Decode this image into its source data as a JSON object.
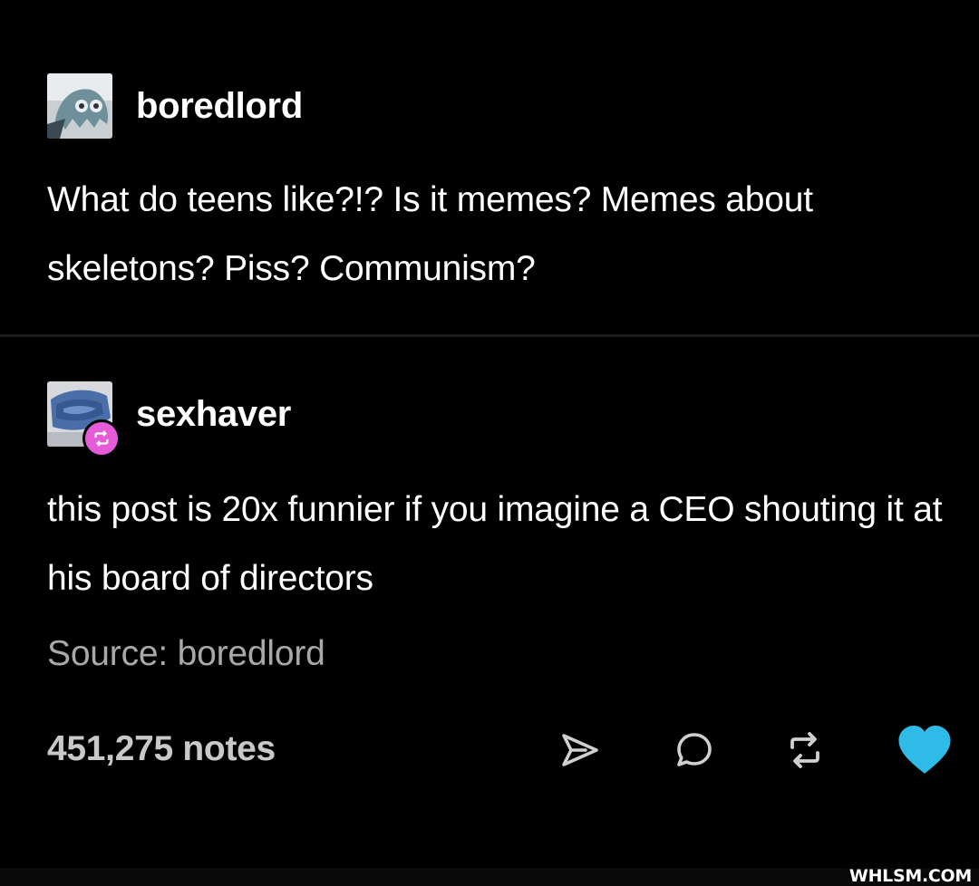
{
  "original_post": {
    "username": "boredlord",
    "avatar_icon": "ghost-avatar-icon",
    "text": "What do teens like?!? Is it memes? Memes about skeletons? Piss? Communism?"
  },
  "reblog_post": {
    "username": "sexhaver",
    "avatar_icon": "blue-painted-avatar-icon",
    "badge_icon": "reblog-badge-icon",
    "text": "this post is 20x funnier if you imagine a CEO shouting it at his board of directors",
    "source": "Source: boredlord"
  },
  "footer": {
    "notes": "451,275 notes",
    "actions": [
      "share-icon",
      "reply-icon",
      "reblog-icon",
      "like-icon"
    ]
  },
  "watermark": "WHLSM.COM",
  "colors": {
    "background": "#000000",
    "text": "#ffffff",
    "muted": "#a9a9a9",
    "badge": "#e55bd8",
    "like": "#2fbbe8"
  }
}
